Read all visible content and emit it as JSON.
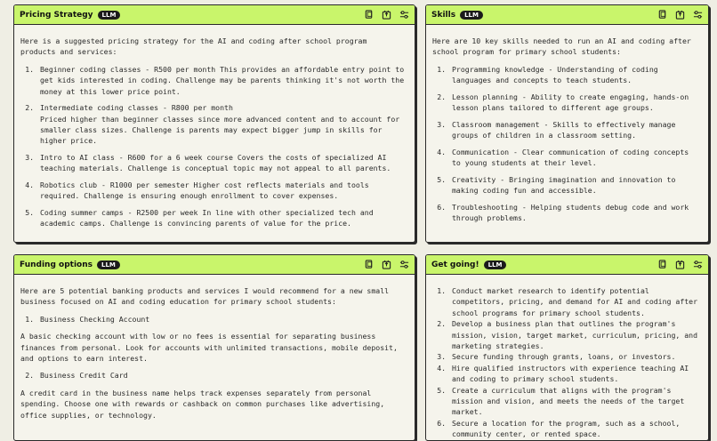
{
  "cards": {
    "pricing": {
      "title": "Pricing Strategy",
      "badge": "LLM",
      "intro": "Here is a suggested pricing strategy for the AI and coding after school program products and services:",
      "items": [
        "Beginner coding classes - R500 per month This provides an affordable entry point to get kids interested in coding. Challenge may be parents thinking it's not worth the money at this lower price point.",
        "Intermediate coding classes - R800 per month",
        "Intro to AI class - R600 for a 6 week course Covers the costs of specialized AI teaching materials. Challenge is conceptual topic may not appeal to all parents.",
        "Robotics club - R1000 per semester Higher cost reflects materials and tools required. Challenge is ensuring enough enrollment to cover expenses.",
        "Coding summer camps - R2500 per week In line with other specialized tech and academic camps. Challenge is convincing parents of value for the price."
      ],
      "item2_detail": "Priced higher than beginner classes since more advanced content and to account for smaller class sizes. Challenge is parents may expect bigger jump in skills for higher price."
    },
    "skills": {
      "title": "Skills",
      "badge": "LLM",
      "intro": "Here are 10 key skills needed to run an AI and coding after school program for primary school students:",
      "items": [
        "Programming knowledge - Understanding of coding languages and concepts to teach students.",
        "Lesson planning - Ability to create engaging, hands-on lesson plans tailored to different age groups.",
        "Classroom management - Skills to effectively manage groups of children in a classroom setting.",
        "Communication - Clear communication of coding concepts to young students at their level.",
        "Creativity - Bringing imagination and innovation to making coding fun and accessible.",
        "Troubleshooting - Helping students debug code and work through problems."
      ]
    },
    "funding": {
      "title": "Funding options",
      "badge": "LLM",
      "intro": "Here are 5 potential banking products and services I would recommend for a new small business focused on AI and coding education for primary school students:",
      "item1": "Business Checking Account",
      "para1": "A basic checking account with low or no fees is essential for separating business finances from personal. Look for accounts with unlimited transactions, mobile deposit, and options to earn interest.",
      "item2": "Business Credit Card",
      "para2": "A credit card in the business name helps track expenses separately from personal spending. Choose one with rewards or cashback on common purchases like advertising, office supplies, or technology."
    },
    "getgoing": {
      "title": "Get going!",
      "badge": "LLM",
      "items": [
        "Conduct market research to identify potential competitors, pricing, and demand for AI and coding after school programs for primary school students.",
        "Develop a business plan that outlines the program's mission, vision, target market, curriculum, pricing, and marketing strategies.",
        "Secure funding through grants, loans, or investors.",
        "Hire qualified instructors with experience teaching AI and coding to primary school students.",
        "Create a curriculum that aligns with the program's mission and vision, and meets the needs of the target market.",
        "Secure a location for the program, such as a school, community center, or rented space."
      ]
    }
  },
  "icons": [
    "copy-icon",
    "export-icon",
    "settings-sliders-icon"
  ],
  "colors": {
    "header": "#c9f56b",
    "background": "#efeee4",
    "badge": "#1b1b1b"
  }
}
